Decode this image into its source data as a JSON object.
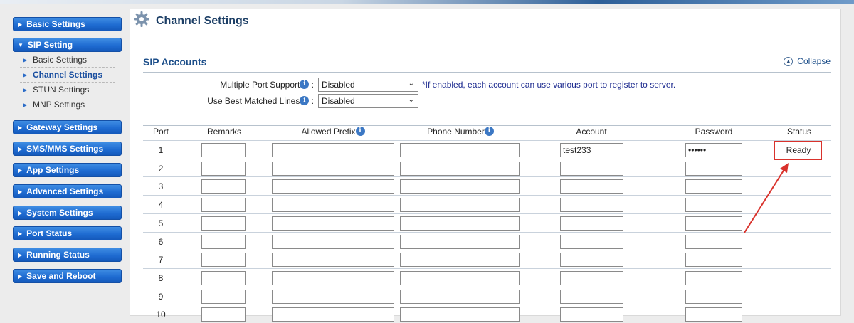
{
  "sidebar": {
    "menu": [
      {
        "label": "Basic Settings"
      },
      {
        "label": "SIP Setting"
      },
      {
        "label": "Gateway Settings"
      },
      {
        "label": "SMS/MMS Settings"
      },
      {
        "label": "App Settings"
      },
      {
        "label": "Advanced Settings"
      },
      {
        "label": "System Settings"
      },
      {
        "label": "Port Status"
      },
      {
        "label": "Running Status"
      },
      {
        "label": "Save and Reboot"
      }
    ],
    "sip_submenu": [
      {
        "label": "Basic Settings"
      },
      {
        "label": "Channel Settings"
      },
      {
        "label": "STUN Settings"
      },
      {
        "label": "MNP Settings"
      }
    ]
  },
  "page": {
    "title": "Channel Settings",
    "section": "SIP Accounts",
    "collapse_label": "Collapse"
  },
  "options": {
    "multiple_port_label": "Multiple Port Support",
    "multiple_port_value": "Disabled",
    "multiple_port_hint": "*If enabled, each account can use various port to register to server.",
    "best_matched_label": "Use Best Matched Lines",
    "best_matched_value": "Disabled"
  },
  "table": {
    "columns": [
      "Port",
      "Remarks",
      "Allowed Prefix",
      "Phone Number",
      "Account",
      "Password",
      "Status"
    ],
    "rows": [
      {
        "port": "1",
        "account": "test233",
        "password": "••••••",
        "status": "Ready"
      },
      {
        "port": "2",
        "account": "",
        "password": "",
        "status": ""
      },
      {
        "port": "3",
        "account": "",
        "password": "",
        "status": ""
      },
      {
        "port": "4",
        "account": "",
        "password": "",
        "status": ""
      },
      {
        "port": "5",
        "account": "",
        "password": "",
        "status": ""
      },
      {
        "port": "6",
        "account": "",
        "password": "",
        "status": ""
      },
      {
        "port": "7",
        "account": "",
        "password": "",
        "status": ""
      },
      {
        "port": "8",
        "account": "",
        "password": "",
        "status": ""
      },
      {
        "port": "9",
        "account": "",
        "password": "",
        "status": ""
      },
      {
        "port": "10",
        "account": "",
        "password": "",
        "status": ""
      }
    ]
  },
  "colors": {
    "nav_blue": "#1f6cd2",
    "accent_red": "#d9322c",
    "title_blue": "#1d4f8a"
  }
}
